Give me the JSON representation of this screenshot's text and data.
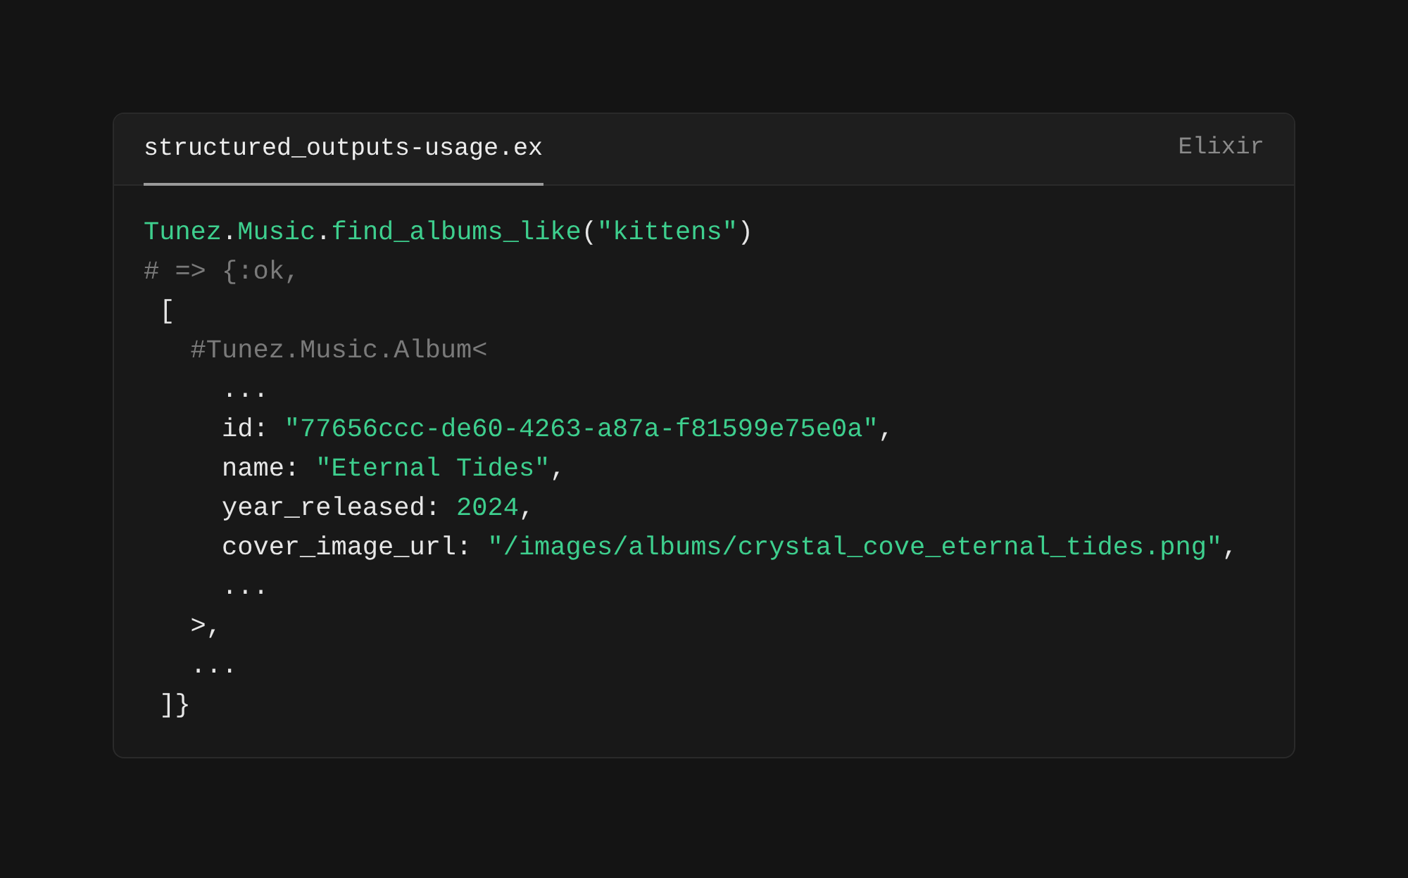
{
  "code_block": {
    "tabs": [
      {
        "label": "structured_outputs-usage.ex",
        "selected": true
      }
    ],
    "language": "Elixir",
    "lines": [
      [
        {
          "kind": "module",
          "text": "Tunez"
        },
        {
          "kind": "plain",
          "text": "."
        },
        {
          "kind": "module",
          "text": "Music"
        },
        {
          "kind": "plain",
          "text": "."
        },
        {
          "kind": "function",
          "text": "find_albums_like"
        },
        {
          "kind": "plain",
          "text": "("
        },
        {
          "kind": "string",
          "text": "\"kittens\""
        },
        {
          "kind": "plain",
          "text": ")"
        }
      ],
      [
        {
          "kind": "comment",
          "text": "# => {:ok,"
        }
      ],
      [
        {
          "kind": "plain",
          "text": " ["
        }
      ],
      [
        {
          "kind": "comment",
          "text": "   #Tunez.Music.Album<"
        }
      ],
      [
        {
          "kind": "plain",
          "text": "     ..."
        }
      ],
      [
        {
          "kind": "plain",
          "text": "     id: "
        },
        {
          "kind": "string",
          "text": "\"77656ccc-de60-4263-a87a-f81599e75e0a\""
        },
        {
          "kind": "plain",
          "text": ","
        }
      ],
      [
        {
          "kind": "plain",
          "text": "     name: "
        },
        {
          "kind": "string",
          "text": "\"Eternal Tides\""
        },
        {
          "kind": "plain",
          "text": ","
        }
      ],
      [
        {
          "kind": "plain",
          "text": "     year_released: "
        },
        {
          "kind": "number",
          "text": "2024"
        },
        {
          "kind": "plain",
          "text": ","
        }
      ],
      [
        {
          "kind": "plain",
          "text": "     cover_image_url: "
        },
        {
          "kind": "string",
          "text": "\"/images/albums/crystal_cove_eternal_tides.png\""
        },
        {
          "kind": "plain",
          "text": ","
        }
      ],
      [
        {
          "kind": "plain",
          "text": "     ..."
        }
      ],
      [
        {
          "kind": "plain",
          "text": "   >,"
        }
      ],
      [
        {
          "kind": "plain",
          "text": "   ..."
        }
      ],
      [
        {
          "kind": "plain",
          "text": " ]}"
        }
      ]
    ]
  }
}
